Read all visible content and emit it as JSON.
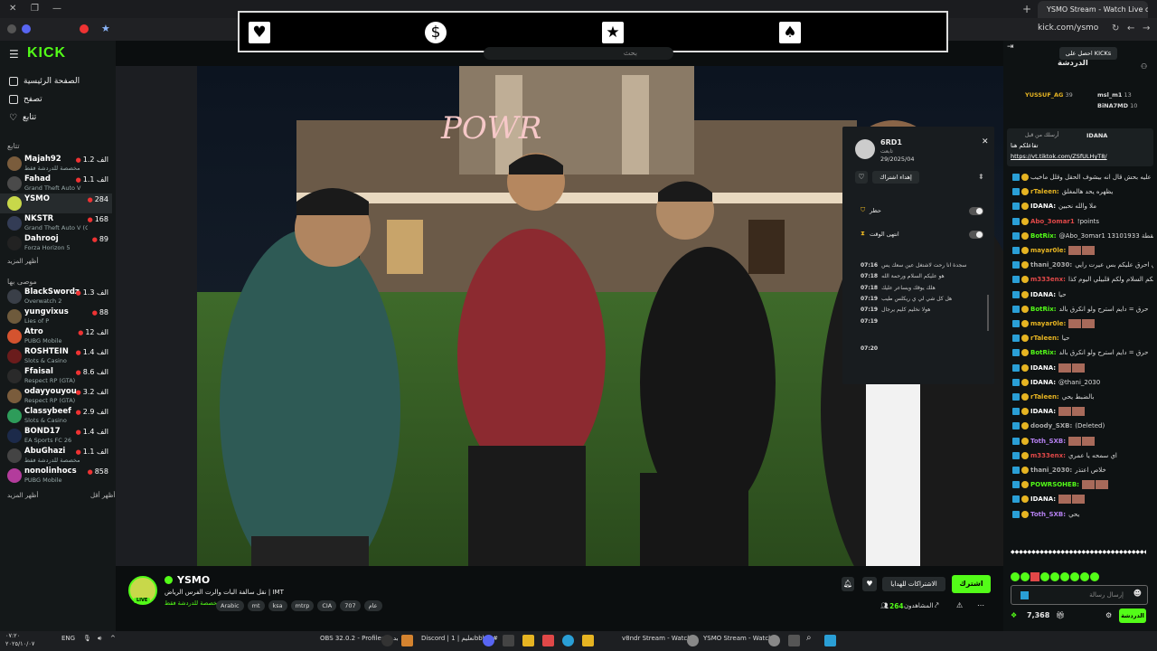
{
  "browser": {
    "tab_title": "YSMO Stream - Watch Live on",
    "url": "kick.com/ysmo"
  },
  "overlay": {
    "suits": [
      "♥",
      "$",
      "★",
      "♠"
    ],
    "suit_icons": [
      "heart-icon",
      "dollar-icon",
      "star-icon",
      "spade-icon"
    ],
    "search_placeholder": "بحث"
  },
  "sidebar": {
    "logo": "KICK",
    "nav": [
      {
        "label": "الصفحة الرئيسية",
        "icon": "home-icon"
      },
      {
        "label": "تصفح",
        "icon": "browse-icon"
      },
      {
        "label": "تتابع",
        "icon": "heart-icon"
      }
    ],
    "following_header": "تتابع",
    "following": [
      {
        "name": "Majah92",
        "game": "مخصصة للدردشة فقط",
        "viewers": "1.2 الف",
        "color": "#7a5c3c"
      },
      {
        "name": "Fahad",
        "game": "Grand Theft Auto V",
        "viewers": "1.1 الف",
        "color": "#4a4a4a"
      },
      {
        "name": "YSMO",
        "game": "",
        "viewers": "284",
        "color": "#c8d84a"
      },
      {
        "name": "NKSTR",
        "game": "Grand Theft Auto V (G...",
        "viewers": "168",
        "color": "#333c55"
      },
      {
        "name": "Dahrooj",
        "game": "Forza Horizon 5",
        "viewers": "89",
        "color": "#222"
      }
    ],
    "show_more_following": "أظهر المزيد",
    "recommended_header": "موصى بها",
    "recommended": [
      {
        "name": "BlackSwordz",
        "game": "Overwatch 2",
        "viewers": "1.3 الف",
        "color": "#3a3f48"
      },
      {
        "name": "yungvixus",
        "game": "Lies of P",
        "viewers": "88",
        "color": "#6e5a3c"
      },
      {
        "name": "Atro",
        "game": "PUBG Mobile",
        "viewers": "12 الف",
        "color": "#d4532f"
      },
      {
        "name": "ROSHTEIN",
        "game": "Slots & Casino",
        "viewers": "1.4 الف",
        "color": "#6a1c1c"
      },
      {
        "name": "Ffaisal",
        "game": "Respect RP (GTA)",
        "viewers": "8.6 الف",
        "color": "#2a2a2a"
      },
      {
        "name": "odayyouyou",
        "game": "Respect RP (GTA)",
        "viewers": "3.2 الف",
        "color": "#7a5c3c"
      },
      {
        "name": "Classybeef",
        "game": "Slots & Casino",
        "viewers": "2.9 الف",
        "color": "#2e9c5a"
      },
      {
        "name": "BOND17",
        "game": "EA Sports FC 26",
        "viewers": "1.4 الف",
        "color": "#1c2a4a"
      },
      {
        "name": "AbuGhazi",
        "game": "مخصصة للدردشة فقط",
        "viewers": "1.1 الف",
        "color": "#444"
      },
      {
        "name": "nonolinhocs",
        "game": "PUBG Mobile",
        "viewers": "858",
        "color": "#b33c9c"
      }
    ],
    "show_more": "أظهر المزيد",
    "show_less": "أظهر أقل"
  },
  "modpanel": {
    "username": "6RD1",
    "sub_label": "تابعت",
    "date": "29/2025/04",
    "follow_btn": "إهداء اشتراك",
    "ban_label": "حظر",
    "timeout_label": "انتهى الوقت",
    "log": [
      {
        "time": "07:16",
        "text": "سجدة انا رحت لاشتغل عين سعك يس"
      },
      {
        "time": "07:18",
        "text": "هو عليكم السلام ورحمة الله"
      },
      {
        "time": "07:18",
        "text": "هلك يوقك ويساعر عليك"
      },
      {
        "time": "07:19",
        "text": "هل كل شي لي ي ريكلس طيب"
      },
      {
        "time": "07:19",
        "text": "هولا نخليم كليم يرجال"
      },
      {
        "time": "07:19",
        "text": ""
      },
      {
        "time": "07:20",
        "text": ""
      }
    ]
  },
  "channel": {
    "name": "YSMO",
    "title": "نقل سالفة البات والرت الفرس الرياض | IMT",
    "category": "مخصصة للدردشة فقط",
    "tags": [
      "Arabic",
      "mt",
      "ksa",
      "mtrp",
      "CIA",
      "707",
      "عام"
    ],
    "subscribe_btn": "اشترك",
    "gift_btn": "الاشتراكات للهدايا",
    "viewers": "264",
    "viewers_label": "المشاهدون",
    "live_badge": "LIVE"
  },
  "chat": {
    "header": "الدردشة",
    "get_kicks": "احصل على KICKs",
    "top_gifters": [
      {
        "name": "YUSSUF_AG",
        "count": "39"
      },
      {
        "name": "msl_m1",
        "count": "13"
      },
      {
        "name": "BiNA7MD",
        "count": "10"
      }
    ],
    "pinned_user": "IDANA",
    "pinned_label": "أرسلك من قبل",
    "pinned_text": "تفاعلكم هنا",
    "pinned_link": "https://vt.tiktok.com/ZSfULHyT8/",
    "messages": [
      {
        "user": "",
        "text": "يضرونه سحبت عليه بحش قال انه بيشوف الحقل وقلل ماخيب",
        "color": "#ccc"
      },
      {
        "user": "rTaleen:",
        "text": "يظهره يحد هالمغلق",
        "color": "#e6b422"
      },
      {
        "user": "IDANA:",
        "text": "ملا والله نحبين",
        "color": "#fff"
      },
      {
        "user": "Abo_3omar1",
        "text": "!points",
        "color": "#e04848"
      },
      {
        "user": "BotRix:",
        "text": "@Abo_3omar1 13101933 نقطة",
        "color": "#53fc18"
      },
      {
        "user": "mayar0le:",
        "text": "",
        "color": "#e6b422"
      },
      {
        "user": "thani_2030:",
        "text": "ودي احرق عليكم بس عيرت رايي",
        "color": "#aaa"
      },
      {
        "user": "m333enx:",
        "text": "وعليكم السلام ولكم قلبيلي اليوم كذا",
        "color": "#e04848"
      },
      {
        "user": "IDANA:",
        "text": "حيا",
        "color": "#fff"
      },
      {
        "user": "BotRix:",
        "text": "حرق = دايم استرح ولو انكرق بالد",
        "color": "#53fc18"
      },
      {
        "user": "mayar0le:",
        "text": "",
        "color": "#e6b422"
      },
      {
        "user": "rTaleen:",
        "text": "حيا",
        "color": "#e6b422"
      },
      {
        "user": "BotRix:",
        "text": "حرق = دايم استرح ولو انكرق بالد",
        "color": "#53fc18"
      },
      {
        "user": "IDANA:",
        "text": "",
        "color": "#fff"
      },
      {
        "user": "IDANA:",
        "text": "@thani_2030",
        "color": "#fff"
      },
      {
        "user": "rTaleen:",
        "text": "بالضبط يحي",
        "color": "#e6b422"
      },
      {
        "user": "IDANA:",
        "text": "",
        "color": "#fff"
      },
      {
        "user": "doody_SXB:",
        "text": "(Deleted)",
        "color": "#aaa"
      },
      {
        "user": "Toth_SXB:",
        "text": "",
        "color": "#b580f0"
      },
      {
        "user": "m333enx:",
        "text": "اي سمحه يا عمري",
        "color": "#e04848"
      },
      {
        "user": "thani_2030:",
        "text": "خلاص اعتذر",
        "color": "#aaa"
      },
      {
        "user": "POWRSOHEB:",
        "text": "",
        "color": "#53fc18"
      },
      {
        "user": "IDANA:",
        "text": "",
        "color": "#fff"
      },
      {
        "user": "Toth_SXB:",
        "text": "يحي",
        "color": "#b580f0"
      }
    ],
    "input_placeholder": "إرسال رسالة",
    "points": "7,368",
    "chat_btn": "الدردشة"
  },
  "taskbar": {
    "time": "٠٧:٢٠",
    "date": "٢٠٢٥/١٠/٠٧",
    "lang": "ENG",
    "items": [
      "OBS 32.0.2 - Profile: بدون",
      "Discord | تعليم | 1bbhm#",
      "v8ndr Stream - Watch L",
      "YSMO Stream - Watch L"
    ]
  }
}
